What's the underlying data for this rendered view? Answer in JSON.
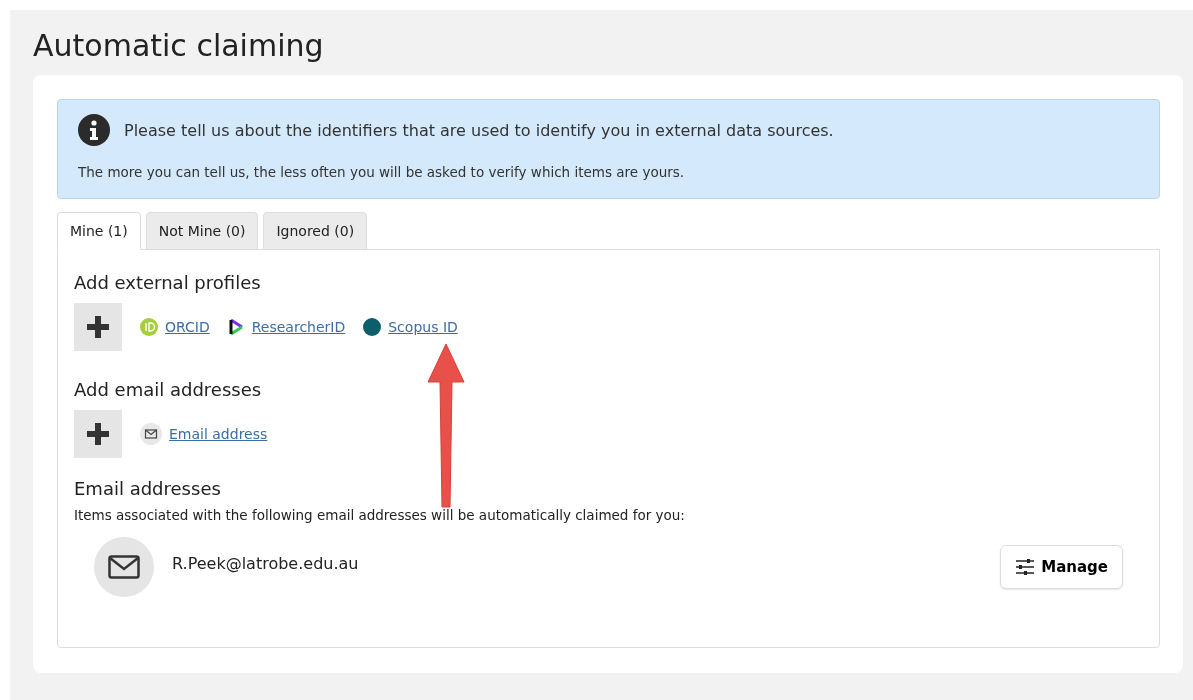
{
  "page_title": "Automatic claiming",
  "info": {
    "heading": "Please tell us about the identifiers that are used to identify you in external data sources.",
    "text": "The more you can tell us, the less often you will be asked to verify which items are yours."
  },
  "tabs": [
    {
      "label": "Mine (1)",
      "selected": true
    },
    {
      "label": "Not Mine (0)",
      "selected": false
    },
    {
      "label": "Ignored (0)",
      "selected": false
    }
  ],
  "profiles": {
    "heading": "Add external profiles",
    "links": [
      {
        "kind": "orcid",
        "label": "ORCID"
      },
      {
        "kind": "researcherid",
        "label": "ResearcherID"
      },
      {
        "kind": "scopus",
        "label": "Scopus ID"
      }
    ]
  },
  "add_email": {
    "heading": "Add email addresses",
    "links": [
      {
        "kind": "email",
        "label": "Email address"
      }
    ]
  },
  "emails": {
    "heading": "Email addresses",
    "text": "Items associated with the following email addresses will be automatically claimed for you:",
    "items": [
      {
        "address": "R.Peek@latrobe.edu.au"
      }
    ],
    "manage_button": "Manage"
  }
}
